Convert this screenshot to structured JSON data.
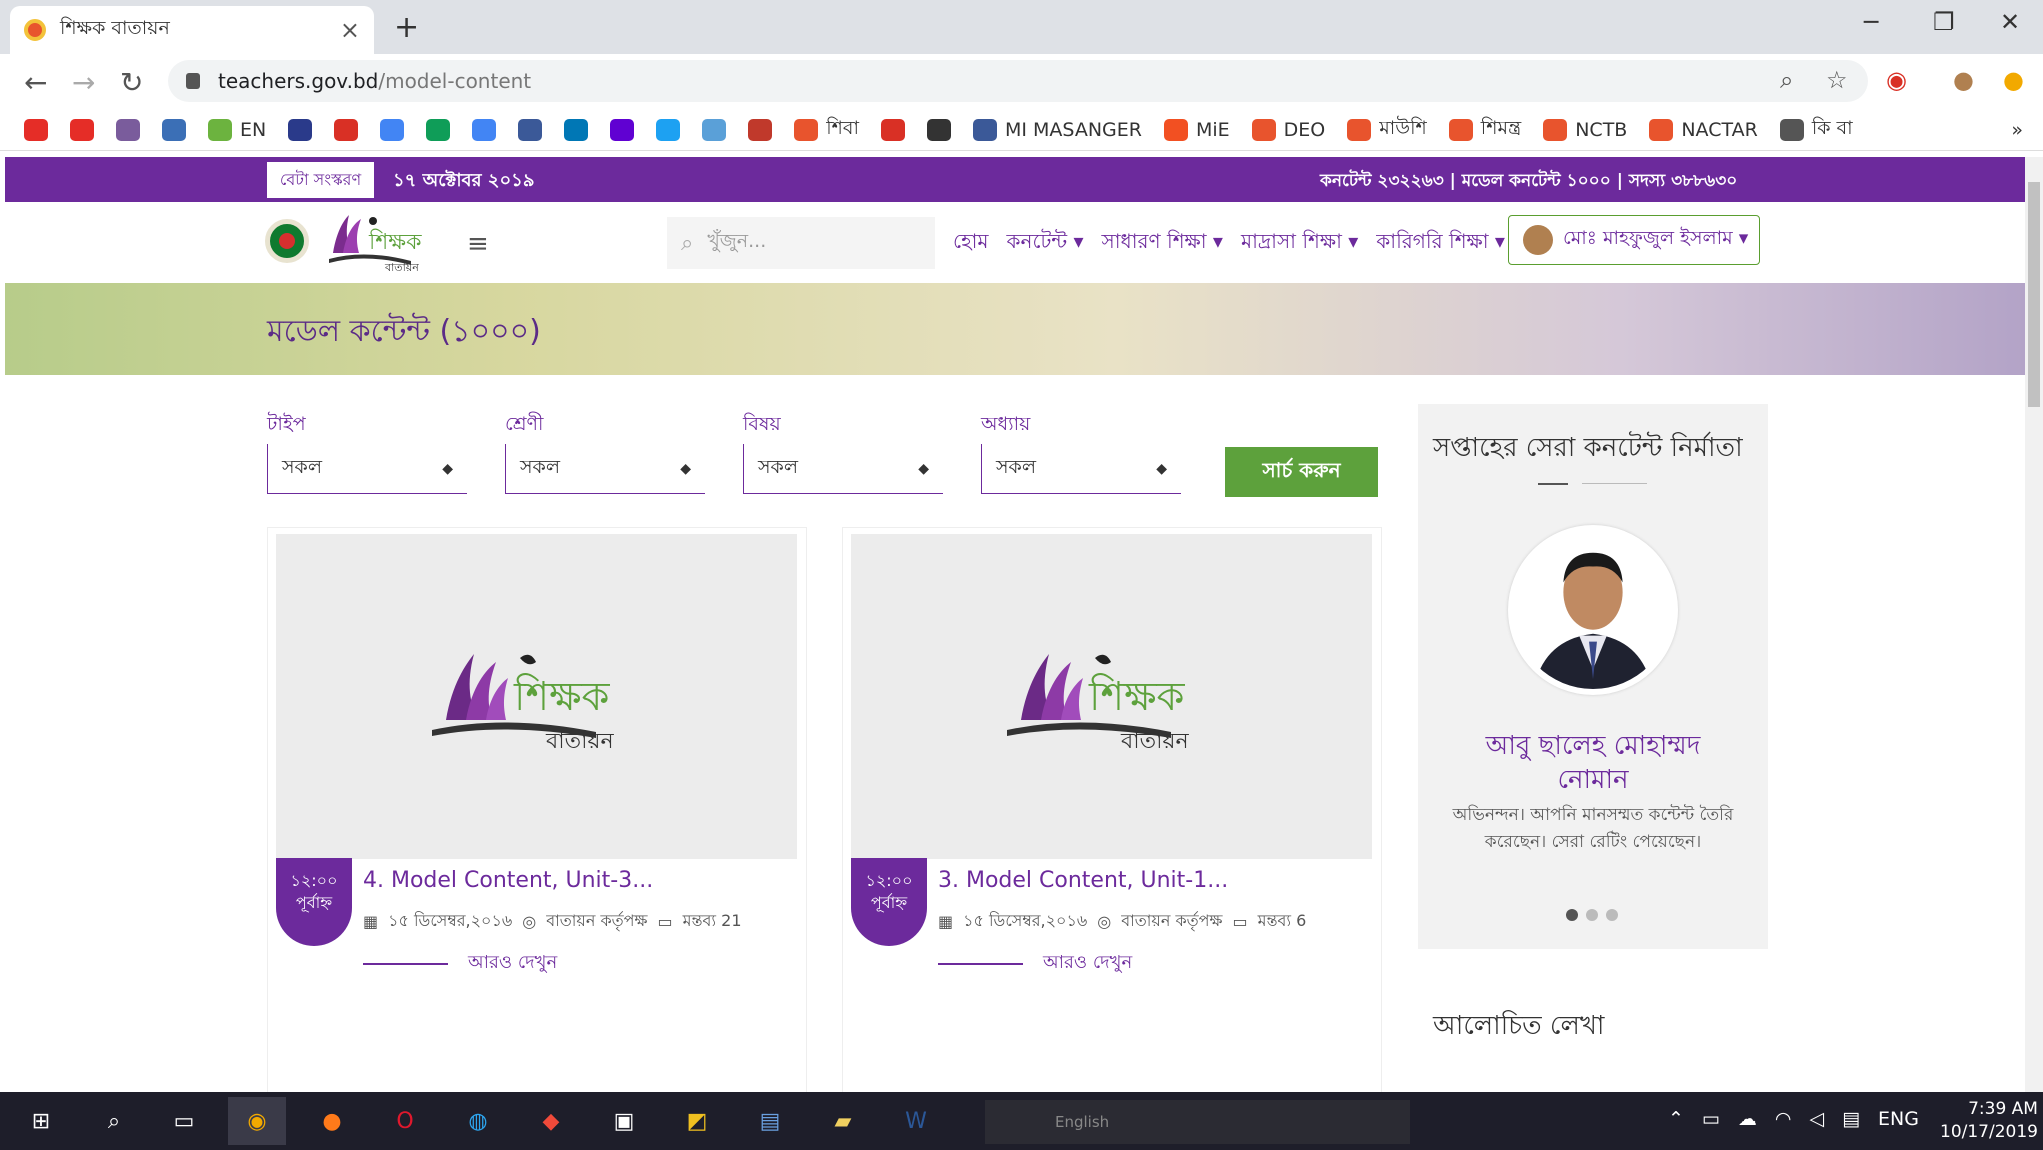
{
  "browser": {
    "tab_title": "শিক্ষক বাতায়ন",
    "close": "×",
    "new_tab": "+",
    "minimize": "─",
    "restore": "❐",
    "close_window": "✕",
    "url_domain": "teachers.gov.bd",
    "url_path": "/model-content",
    "bookmarks": [
      {
        "label": "",
        "color": "#e52d27",
        "icon": "youtube-icon"
      },
      {
        "label": "",
        "color": "#e52d27",
        "icon": "youtube-icon"
      },
      {
        "label": "",
        "color": "#7a5c9c",
        "icon": "globe-icon"
      },
      {
        "label": "",
        "color": "#3b6fb6",
        "icon": "extension-icon"
      },
      {
        "label": "EN",
        "color": "#6cb33f",
        "icon": "download-icon"
      },
      {
        "label": "",
        "color": "#2a3a8a",
        "icon": "seal-icon"
      },
      {
        "label": "",
        "color": "#d93025",
        "icon": "gmail-icon"
      },
      {
        "label": "",
        "color": "#4285f4",
        "icon": "google-icon"
      },
      {
        "label": "",
        "color": "#0f9d58",
        "icon": "drive-icon"
      },
      {
        "label": "",
        "color": "#4285f4",
        "icon": "translate-icon"
      },
      {
        "label": "",
        "color": "#3b5998",
        "icon": "facebook-icon"
      },
      {
        "label": "",
        "color": "#0077b5",
        "icon": "linkedin-icon"
      },
      {
        "label": "",
        "color": "#6001d2",
        "icon": "yahoo-icon"
      },
      {
        "label": "",
        "color": "#1da1f2",
        "icon": "twitter-icon"
      },
      {
        "label": "",
        "color": "#5aa0d8",
        "icon": "chat-icon"
      },
      {
        "label": "",
        "color": "#c0392b",
        "icon": "shield-icon"
      },
      {
        "label": "শিবা",
        "color": "#e8542d",
        "icon": "bd-seal-icon"
      },
      {
        "label": "",
        "color": "#d93025",
        "icon": "pen-icon"
      },
      {
        "label": "",
        "color": "#333333",
        "icon": "apps-icon"
      },
      {
        "label": "MI MASANGER",
        "color": "#3b5998",
        "icon": "facebook-icon"
      },
      {
        "label": "MiE",
        "color": "#f25022",
        "icon": "microsoft-icon"
      },
      {
        "label": "DEO",
        "color": "#e8542d",
        "icon": "bd-seal-icon"
      },
      {
        "label": "মাউশি",
        "color": "#e8542d",
        "icon": "bd-seal-icon"
      },
      {
        "label": "শিমন্ত্র",
        "color": "#e8542d",
        "icon": "bd-seal-icon"
      },
      {
        "label": "NCTB",
        "color": "#e8542d",
        "icon": "bd-seal-icon"
      },
      {
        "label": "NACTAR",
        "color": "#e8542d",
        "icon": "bd-seal-icon"
      },
      {
        "label": "কি বা",
        "color": "#555555",
        "icon": "globe-icon"
      }
    ],
    "more_bookmarks": "»"
  },
  "site": {
    "beta": "বেটা সংস্করণ",
    "date": "১৭ অক্টোবর ২০১৯",
    "stats": "কনটেন্ট ২৩২২৬৩ | মডেল কনটেন্ট ১০০০ | সদস্য ৩৮৮৬৩০",
    "search_placeholder": "খুঁজুন...",
    "menu": [
      "হোম",
      "কনটেন্ট ▾",
      "সাধারণ শিক্ষা ▾",
      "মাদ্রাসা শিক্ষা ▾",
      "কারিগরি শিক্ষা ▾"
    ],
    "user_name": "মোঃ মাহফুজুল ইসলাম ▾",
    "logo_text": "শিক্ষক",
    "logo_sub": "বাতায়ন"
  },
  "banner": {
    "title": "মডেল কন্টেন্ট (১০০০)"
  },
  "filters": [
    {
      "label": "টাইপ",
      "value": "সকল"
    },
    {
      "label": "শ্রেণী",
      "value": "সকল"
    },
    {
      "label": "বিষয়",
      "value": "সকল"
    },
    {
      "label": "অধ্যায়",
      "value": "সকল"
    }
  ],
  "search_button": "সার্চ করুন",
  "cards": [
    {
      "time": "১২:০০",
      "period": "পূর্বাহ্ন",
      "title": "4. Model Content, Unit-3...",
      "date": "১৫ ডিসেম্বর,২০১৬",
      "author": "বাতায়ন কর্তৃপক্ষ",
      "comments": "মন্তব্য 21",
      "more": "আরও দেখুন"
    },
    {
      "time": "১২:০০",
      "period": "পূর্বাহ্ন",
      "title": "3. Model Content, Unit-1...",
      "date": "১৫ ডিসেম্বর,২০১৬",
      "author": "বাতায়ন কর্তৃপক্ষ",
      "comments": "মন্তব্য 6",
      "more": "আরও দেখুন"
    }
  ],
  "sidebar": {
    "top_title": "সপ্তাহের সেরা কনটেন্ট নির্মাতা",
    "name_line1": "আবু ছালেহ মোহাম্মদ",
    "name_line2": "নোমান",
    "message": "অভিনন্দন। আপনি মানসম্মত কন্টেন্ট তৈরি করেছেন। সেরা রেটিং পেয়েছেন।",
    "second_title": "আলোচিত লেখা"
  },
  "taskbar": {
    "lang_input": "English",
    "tray_lang": "ENG",
    "time": "7:39 AM",
    "date": "10/17/2019"
  },
  "colors": {
    "brand": "#6c2a9c",
    "accent": "#5da13c"
  }
}
